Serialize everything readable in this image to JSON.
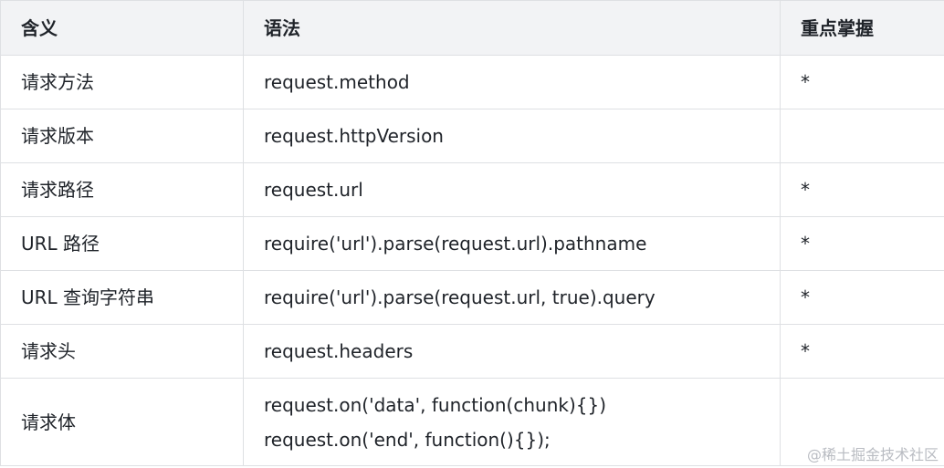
{
  "headers": [
    "含义",
    "语法",
    "重点掌握"
  ],
  "rows": [
    {
      "meaning": "请求方法",
      "syntax": [
        "request.method"
      ],
      "key": "*"
    },
    {
      "meaning": "请求版本",
      "syntax": [
        "request.httpVersion"
      ],
      "key": ""
    },
    {
      "meaning": "请求路径",
      "syntax": [
        "request.url"
      ],
      "key": "*"
    },
    {
      "meaning": "URL 路径",
      "syntax": [
        "require('url').parse(request.url).pathname"
      ],
      "key": "*"
    },
    {
      "meaning": "URL 查询字符串",
      "syntax": [
        "require('url').parse(request.url, true).query"
      ],
      "key": "*"
    },
    {
      "meaning": "请求头",
      "syntax": [
        "request.headers"
      ],
      "key": "*"
    },
    {
      "meaning": "请求体",
      "syntax": [
        "request.on('data', function(chunk){})",
        "request.on('end', function(){});"
      ],
      "key": ""
    }
  ],
  "watermark": "@稀土掘金技术社区"
}
